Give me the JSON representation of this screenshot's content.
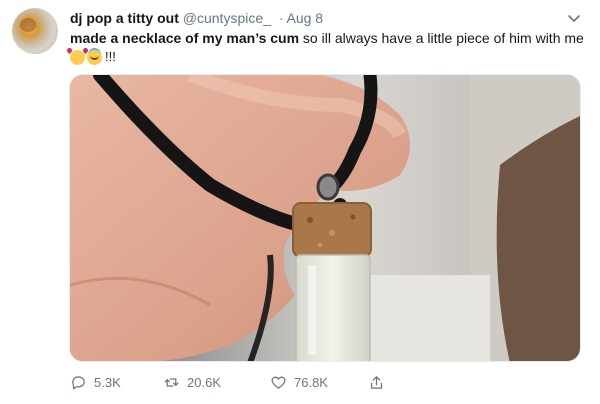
{
  "tweet": {
    "display_name": "dj pop a titty out",
    "handle": "@cuntyspice_",
    "separator": "·",
    "date": "Aug 8",
    "text_bold": "made a necklace of my man’s cum",
    "text_rest": " so ill always have a little piece of him with me",
    "emoji_1": "smiling-face-with-hearts-emoji",
    "emoji_2": "smiling-face-with-halo-emoji",
    "exclaim": "!!!",
    "replies": "5.3K",
    "retweets": "20.6K",
    "likes": "76.8K"
  },
  "icons": {
    "more": "chevron-down-icon",
    "reply": "reply-icon",
    "retweet": "retweet-icon",
    "like": "heart-icon",
    "share": "share-icon"
  },
  "colors": {
    "text": "#14171a",
    "secondary": "#657786",
    "border": "#e6ecf0"
  }
}
